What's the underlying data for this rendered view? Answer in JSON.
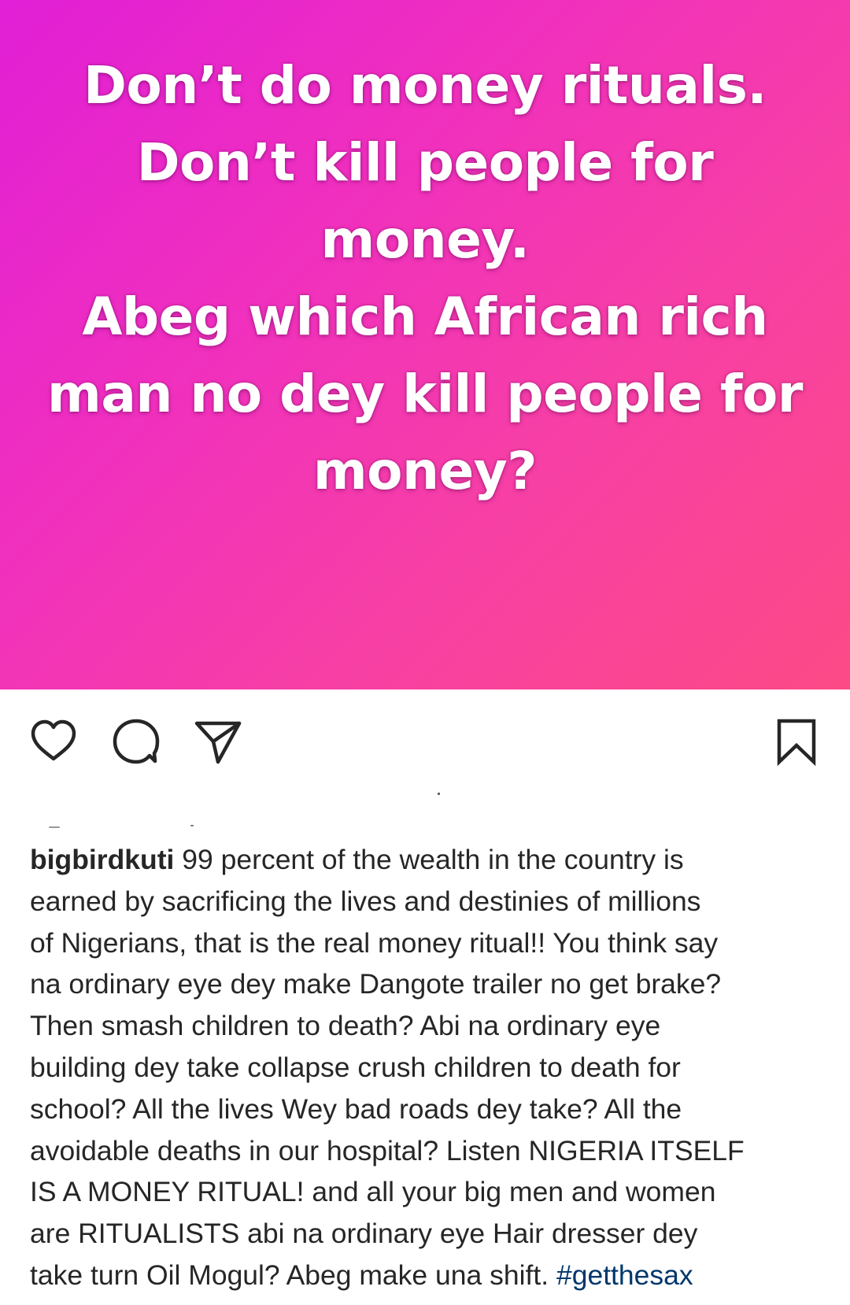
{
  "post_image": {
    "text_lines": [
      "Don’t do money rituals.",
      "Don’t kill people for",
      "money.",
      "Abeg which African rich",
      "man no dey kill people for",
      "money?"
    ],
    "gradient_colors": [
      "#e11fd6",
      "#fc4a86"
    ],
    "text_color": "#ffffff"
  },
  "actions": {
    "like_icon": "heart-icon",
    "comment_icon": "comment-icon",
    "share_icon": "send-icon",
    "save_icon": "bookmark-icon"
  },
  "caption": {
    "username": "bigbirdkuti",
    "lines": [
      "99 percent of the wealth in the country is",
      "earned by sacrificing the lives and destinies of millions",
      "of Nigerians, that is the real money ritual!! You think say",
      "na ordinary eye dey make Dangote trailer no get brake?",
      "Then smash children to death? Abi na ordinary eye",
      "building dey take collapse crush children to death for",
      "school? All the lives Wey bad roads dey take? All the",
      "avoidable deaths in our hospital? Listen NIGERIA ITSELF",
      "IS A MONEY RITUAL! and all your big men and women",
      "are RITUALISTS abi na ordinary eye Hair dresser dey",
      "take turn Oil Mogul? Abeg make una shift."
    ],
    "hashtag": "#getthesax",
    "text_color": "#262626",
    "hashtag_color": "#00376b"
  }
}
